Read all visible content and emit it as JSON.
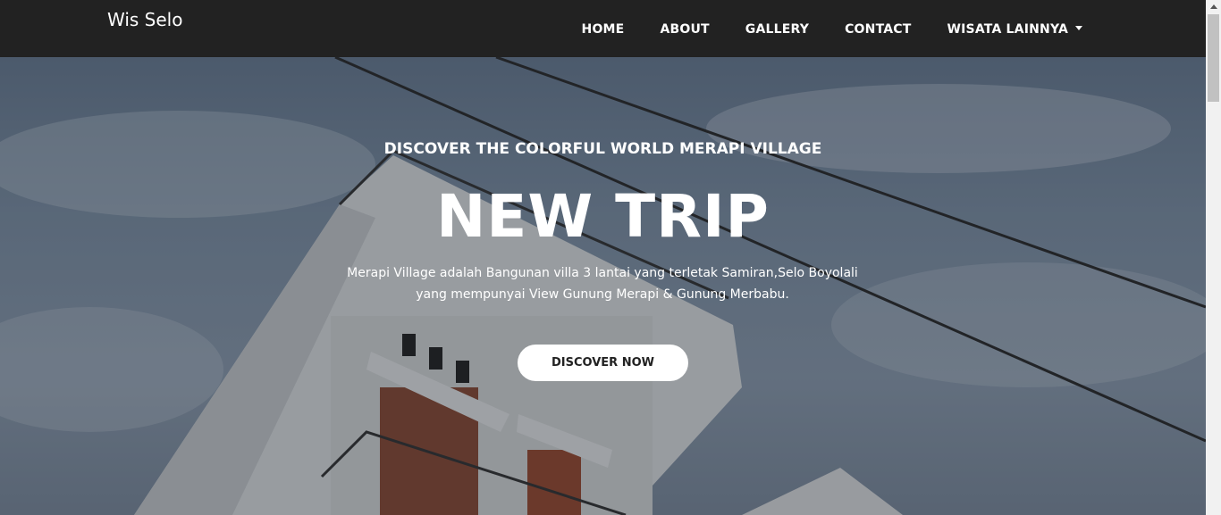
{
  "navbar": {
    "brand": "Wis Selo",
    "items": [
      {
        "label": "HOME"
      },
      {
        "label": "ABOUT"
      },
      {
        "label": "GALLERY"
      },
      {
        "label": "CONTACT"
      },
      {
        "label": "WISATA LAINNYA"
      }
    ]
  },
  "hero": {
    "subtitle": "DISCOVER THE COLORFUL WORLD MERAPI VILLAGE",
    "title": "NEW TRIP",
    "description_line1": "Merapi Village adalah Bangunan villa 3 lantai yang terletak Samiran,Selo Boyolali",
    "description_line2": "yang mempunyai View Gunung Merapi & Gunung Merbabu.",
    "cta_label": "DISCOVER NOW"
  },
  "colors": {
    "navbar_bg": "#222222",
    "text": "#ffffff",
    "button_bg": "#ffffff"
  }
}
